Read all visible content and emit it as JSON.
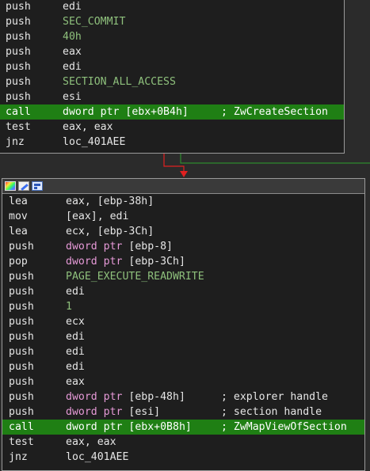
{
  "block1": {
    "lines": [
      {
        "mnemonic": "push",
        "operand": "edi",
        "comment": ""
      },
      {
        "mnemonic": "push",
        "operand": "SEC_COMMIT",
        "comment": ""
      },
      {
        "mnemonic": "push",
        "operand": "40h",
        "comment": ""
      },
      {
        "mnemonic": "push",
        "operand": "eax",
        "comment": ""
      },
      {
        "mnemonic": "push",
        "operand": "edi",
        "comment": ""
      },
      {
        "mnemonic": "push",
        "operand": "SECTION_ALL_ACCESS",
        "comment": ""
      },
      {
        "mnemonic": "push",
        "operand": "esi",
        "comment": ""
      },
      {
        "mnemonic": "call",
        "operand_kw": "dword ptr",
        "operand": "[ebx+0B4h]",
        "comment": "; ZwCreateSection"
      },
      {
        "mnemonic": "test",
        "operand": "eax, eax",
        "comment": ""
      },
      {
        "mnemonic": "jnz",
        "operand": "loc_401AEE",
        "comment": ""
      }
    ]
  },
  "block2": {
    "toolbar": [
      "palette-icon",
      "edit-icon",
      "graph-icon"
    ],
    "lines": [
      {
        "mnemonic": "lea",
        "operand": "eax, [ebp-38h]",
        "comment": ""
      },
      {
        "mnemonic": "mov",
        "operand": "[eax], edi",
        "comment": ""
      },
      {
        "mnemonic": "lea",
        "operand": "ecx, [ebp-3Ch]",
        "comment": ""
      },
      {
        "mnemonic": "push",
        "operand_kw": "dword ptr",
        "operand": "[ebp-8]",
        "comment": ""
      },
      {
        "mnemonic": "pop",
        "operand_kw": "dword ptr",
        "operand": "[ebp-3Ch]",
        "comment": ""
      },
      {
        "mnemonic": "push",
        "operand": "PAGE_EXECUTE_READWRITE",
        "comment": ""
      },
      {
        "mnemonic": "push",
        "operand": "edi",
        "comment": ""
      },
      {
        "mnemonic": "push",
        "operand": "1",
        "comment": ""
      },
      {
        "mnemonic": "push",
        "operand": "ecx",
        "comment": ""
      },
      {
        "mnemonic": "push",
        "operand": "edi",
        "comment": ""
      },
      {
        "mnemonic": "push",
        "operand": "edi",
        "comment": ""
      },
      {
        "mnemonic": "push",
        "operand": "edi",
        "comment": ""
      },
      {
        "mnemonic": "push",
        "operand": "eax",
        "comment": ""
      },
      {
        "mnemonic": "push",
        "operand_kw": "dword ptr",
        "operand": "[ebp-48h]",
        "comment": "; explorer handle"
      },
      {
        "mnemonic": "push",
        "operand_kw": "dword ptr",
        "operand": "[esi]",
        "comment": "; section handle"
      },
      {
        "mnemonic": "call",
        "operand_kw": "dword ptr",
        "operand": "[ebx+0B8h]",
        "comment": "; ZwMapViewOfSection"
      },
      {
        "mnemonic": "test",
        "operand": "eax, eax",
        "comment": ""
      },
      {
        "mnemonic": "jnz",
        "operand": "loc_401AEE",
        "comment": ""
      }
    ]
  },
  "colors": {
    "background": "#2b2b2b",
    "block_bg": "#1e1e1e",
    "highlight": "#1f7f14",
    "keyword": "#e79ad8",
    "constant": "#8ec07c",
    "edge_true": "#2e8b2e",
    "edge_false": "#e02020"
  }
}
